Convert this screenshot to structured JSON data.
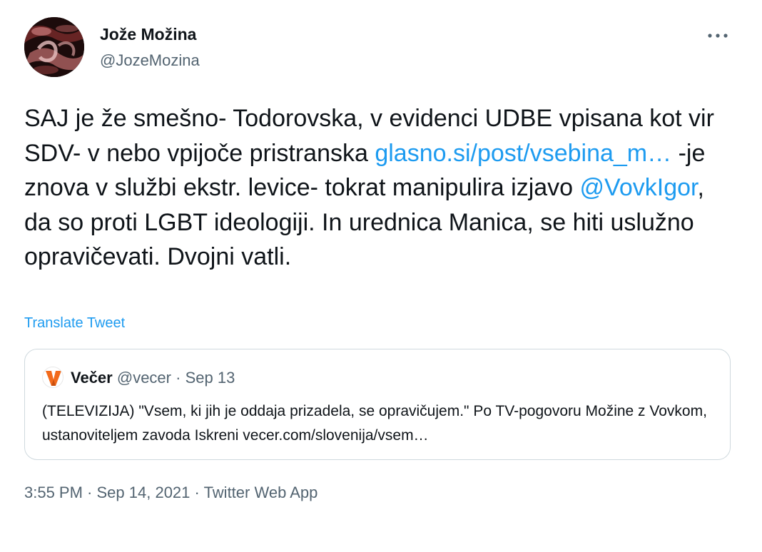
{
  "author": {
    "name": "Jože Možina",
    "handle": "@JozeMozina"
  },
  "tweet": {
    "text_part1": "SAJ je že smešno- Todorovska, v evidenci UDBE vpisana kot vir SDV- v nebo vpijoče pristranska ",
    "link": "glasno.si/post/vsebina_m…",
    "text_part2": " -je znova v službi ekstr. levice- tokrat manipulira izjavo ",
    "mention": "@VovkIgor",
    "text_part3": ", da so proti LGBT ideologiji. In urednica Manica, se hiti uslužno opravičevati. Dvojni vatli.",
    "translate_label": "Translate Tweet"
  },
  "quote": {
    "name": "Večer",
    "handle": "@vecer",
    "separator": "·",
    "date": "Sep 13",
    "text": "(TELEVIZIJA) \"Vsem, ki jih je oddaja prizadela, se opravičujem.\" Po TV-pogovoru Možine z Vovkom, ustanoviteljem zavoda Iskreni vecer.com/slovenija/vsem…",
    "logo_letter": "V"
  },
  "meta": {
    "time": "3:55 PM",
    "separator": " · ",
    "date": "Sep 14, 2021",
    "source": "Twitter Web App"
  },
  "colors": {
    "link": "#1d9bf0",
    "secondary_text": "#536471",
    "primary_text": "#0f1419",
    "border": "#cfd9de",
    "vecer_orange": "#f26a1b"
  },
  "icons": {
    "more": "more-horizontal-icon",
    "quote_logo": "vecer-logo-icon"
  }
}
